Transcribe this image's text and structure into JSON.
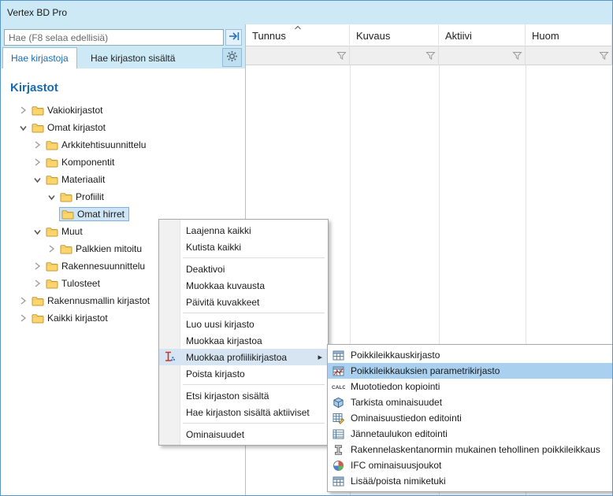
{
  "window_title": "Vertex BD Pro",
  "search": {
    "placeholder": "Hae (F8 selaa edellisiä)"
  },
  "tabs": [
    {
      "label": "Hae kirjastoja",
      "active": true
    },
    {
      "label": "Hae kirjaston sisältä",
      "active": false
    }
  ],
  "tree": {
    "title": "Kirjastot",
    "items": [
      {
        "label": "Vakiokirjastot",
        "level": 0,
        "state": "collapsed"
      },
      {
        "label": "Omat kirjastot",
        "level": 0,
        "state": "expanded"
      },
      {
        "label": "Arkkitehtisuunnittelu",
        "level": 1,
        "state": "collapsed"
      },
      {
        "label": "Komponentit",
        "level": 1,
        "state": "collapsed"
      },
      {
        "label": "Materiaalit",
        "level": 1,
        "state": "expanded"
      },
      {
        "label": "Profiilit",
        "level": 2,
        "state": "expanded"
      },
      {
        "label": "Omat hirret",
        "level": 3,
        "state": "leaf",
        "selected": true
      },
      {
        "label": "Muut",
        "level": 1,
        "state": "expanded"
      },
      {
        "label": "Palkkien mitoitu",
        "level": 2,
        "state": "collapsed"
      },
      {
        "label": "Rakennesuunnittelu",
        "level": 1,
        "state": "collapsed"
      },
      {
        "label": "Tulosteet",
        "level": 1,
        "state": "collapsed"
      },
      {
        "label": "Rakennusmallin kirjastot",
        "level": 0,
        "state": "collapsed"
      },
      {
        "label": "Kaikki kirjastot",
        "level": 0,
        "state": "collapsed"
      }
    ]
  },
  "table": {
    "columns": [
      {
        "label": "Tunnus",
        "sorted": "asc"
      },
      {
        "label": "Kuvaus"
      },
      {
        "label": "Aktiivi"
      },
      {
        "label": "Huom"
      }
    ],
    "rows": []
  },
  "context_menu": {
    "items": [
      {
        "label": "Laajenna kaikki"
      },
      {
        "label": "Kutista kaikki",
        "separator_after": true
      },
      {
        "label": "Deaktivoi"
      },
      {
        "label": "Muokkaa kuvausta"
      },
      {
        "label": "Päivitä kuvakkeet",
        "separator_after": true
      },
      {
        "label": "Luo uusi kirjasto"
      },
      {
        "label": "Muokkaa kirjastoa"
      },
      {
        "label": "Muokkaa profiilikirjastoa",
        "highlighted": true,
        "has_submenu": true,
        "icon": "profile-library-edit-icon"
      },
      {
        "label": "Poista kirjasto",
        "separator_after": true
      },
      {
        "label": "Etsi kirjaston sisältä"
      },
      {
        "label": "Hae kirjaston sisältä aktiiviset",
        "separator_after": true
      },
      {
        "label": "Ominaisuudet"
      }
    ]
  },
  "submenu": {
    "items": [
      {
        "label": "Poikkileikkauskirjasto",
        "icon": "section-table-icon"
      },
      {
        "label": "Poikkileikkauksien parametrikirjasto",
        "icon": "section-parameter-table-icon",
        "highlighted": true
      },
      {
        "label": "Muototiedon kopiointi",
        "icon": "calc-icon"
      },
      {
        "label": "Tarkista ominaisuudet",
        "icon": "cube-icon"
      },
      {
        "label": "Ominaisuustiedon editointi",
        "icon": "table-edit-icon"
      },
      {
        "label": "Jännetaulukon editointi",
        "icon": "span-table-icon"
      },
      {
        "label": "Rakennelaskentanormin mukainen tehollinen poikkileikkaus",
        "icon": "effective-section-icon"
      },
      {
        "label": "IFC ominaisuusjoukot",
        "icon": "ifc-icon"
      },
      {
        "label": "Lisää/poista nimiketuki",
        "icon": "item-grid-icon"
      }
    ]
  },
  "colors": {
    "titlebar_bg": "#cde9f6",
    "accent_blue": "#1a6ab2",
    "tree_selection_bg": "#cde5f7",
    "menu_highlight_bg": "#d7e5f2",
    "submenu_highlight_bg": "#a9d1ef"
  }
}
